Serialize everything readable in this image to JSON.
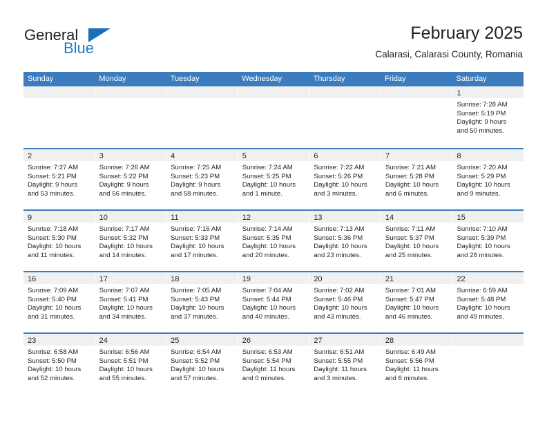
{
  "brand": {
    "name_part1": "General",
    "name_part2": "Blue"
  },
  "header": {
    "title": "February 2025",
    "subtitle": "Calarasi, Calarasi County, Romania"
  },
  "calendar": {
    "weekday_headers": [
      "Sunday",
      "Monday",
      "Tuesday",
      "Wednesday",
      "Thursday",
      "Friday",
      "Saturday"
    ],
    "accent_color": "#3a7cbe",
    "daynum_band_color": "#f0f0f0",
    "weeks": [
      [
        {
          "day": "",
          "lines": []
        },
        {
          "day": "",
          "lines": []
        },
        {
          "day": "",
          "lines": []
        },
        {
          "day": "",
          "lines": []
        },
        {
          "day": "",
          "lines": []
        },
        {
          "day": "",
          "lines": []
        },
        {
          "day": "1",
          "lines": [
            "Sunrise: 7:28 AM",
            "Sunset: 5:19 PM",
            "Daylight: 9 hours",
            "and 50 minutes."
          ]
        }
      ],
      [
        {
          "day": "2",
          "lines": [
            "Sunrise: 7:27 AM",
            "Sunset: 5:21 PM",
            "Daylight: 9 hours",
            "and 53 minutes."
          ]
        },
        {
          "day": "3",
          "lines": [
            "Sunrise: 7:26 AM",
            "Sunset: 5:22 PM",
            "Daylight: 9 hours",
            "and 56 minutes."
          ]
        },
        {
          "day": "4",
          "lines": [
            "Sunrise: 7:25 AM",
            "Sunset: 5:23 PM",
            "Daylight: 9 hours",
            "and 58 minutes."
          ]
        },
        {
          "day": "5",
          "lines": [
            "Sunrise: 7:24 AM",
            "Sunset: 5:25 PM",
            "Daylight: 10 hours",
            "and 1 minute."
          ]
        },
        {
          "day": "6",
          "lines": [
            "Sunrise: 7:22 AM",
            "Sunset: 5:26 PM",
            "Daylight: 10 hours",
            "and 3 minutes."
          ]
        },
        {
          "day": "7",
          "lines": [
            "Sunrise: 7:21 AM",
            "Sunset: 5:28 PM",
            "Daylight: 10 hours",
            "and 6 minutes."
          ]
        },
        {
          "day": "8",
          "lines": [
            "Sunrise: 7:20 AM",
            "Sunset: 5:29 PM",
            "Daylight: 10 hours",
            "and 9 minutes."
          ]
        }
      ],
      [
        {
          "day": "9",
          "lines": [
            "Sunrise: 7:18 AM",
            "Sunset: 5:30 PM",
            "Daylight: 10 hours",
            "and 11 minutes."
          ]
        },
        {
          "day": "10",
          "lines": [
            "Sunrise: 7:17 AM",
            "Sunset: 5:32 PM",
            "Daylight: 10 hours",
            "and 14 minutes."
          ]
        },
        {
          "day": "11",
          "lines": [
            "Sunrise: 7:16 AM",
            "Sunset: 5:33 PM",
            "Daylight: 10 hours",
            "and 17 minutes."
          ]
        },
        {
          "day": "12",
          "lines": [
            "Sunrise: 7:14 AM",
            "Sunset: 5:35 PM",
            "Daylight: 10 hours",
            "and 20 minutes."
          ]
        },
        {
          "day": "13",
          "lines": [
            "Sunrise: 7:13 AM",
            "Sunset: 5:36 PM",
            "Daylight: 10 hours",
            "and 23 minutes."
          ]
        },
        {
          "day": "14",
          "lines": [
            "Sunrise: 7:11 AM",
            "Sunset: 5:37 PM",
            "Daylight: 10 hours",
            "and 25 minutes."
          ]
        },
        {
          "day": "15",
          "lines": [
            "Sunrise: 7:10 AM",
            "Sunset: 5:39 PM",
            "Daylight: 10 hours",
            "and 28 minutes."
          ]
        }
      ],
      [
        {
          "day": "16",
          "lines": [
            "Sunrise: 7:09 AM",
            "Sunset: 5:40 PM",
            "Daylight: 10 hours",
            "and 31 minutes."
          ]
        },
        {
          "day": "17",
          "lines": [
            "Sunrise: 7:07 AM",
            "Sunset: 5:41 PM",
            "Daylight: 10 hours",
            "and 34 minutes."
          ]
        },
        {
          "day": "18",
          "lines": [
            "Sunrise: 7:05 AM",
            "Sunset: 5:43 PM",
            "Daylight: 10 hours",
            "and 37 minutes."
          ]
        },
        {
          "day": "19",
          "lines": [
            "Sunrise: 7:04 AM",
            "Sunset: 5:44 PM",
            "Daylight: 10 hours",
            "and 40 minutes."
          ]
        },
        {
          "day": "20",
          "lines": [
            "Sunrise: 7:02 AM",
            "Sunset: 5:46 PM",
            "Daylight: 10 hours",
            "and 43 minutes."
          ]
        },
        {
          "day": "21",
          "lines": [
            "Sunrise: 7:01 AM",
            "Sunset: 5:47 PM",
            "Daylight: 10 hours",
            "and 46 minutes."
          ]
        },
        {
          "day": "22",
          "lines": [
            "Sunrise: 6:59 AM",
            "Sunset: 5:48 PM",
            "Daylight: 10 hours",
            "and 49 minutes."
          ]
        }
      ],
      [
        {
          "day": "23",
          "lines": [
            "Sunrise: 6:58 AM",
            "Sunset: 5:50 PM",
            "Daylight: 10 hours",
            "and 52 minutes."
          ]
        },
        {
          "day": "24",
          "lines": [
            "Sunrise: 6:56 AM",
            "Sunset: 5:51 PM",
            "Daylight: 10 hours",
            "and 55 minutes."
          ]
        },
        {
          "day": "25",
          "lines": [
            "Sunrise: 6:54 AM",
            "Sunset: 5:52 PM",
            "Daylight: 10 hours",
            "and 57 minutes."
          ]
        },
        {
          "day": "26",
          "lines": [
            "Sunrise: 6:53 AM",
            "Sunset: 5:54 PM",
            "Daylight: 11 hours",
            "and 0 minutes."
          ]
        },
        {
          "day": "27",
          "lines": [
            "Sunrise: 6:51 AM",
            "Sunset: 5:55 PM",
            "Daylight: 11 hours",
            "and 3 minutes."
          ]
        },
        {
          "day": "28",
          "lines": [
            "Sunrise: 6:49 AM",
            "Sunset: 5:56 PM",
            "Daylight: 11 hours",
            "and 6 minutes."
          ]
        },
        {
          "day": "",
          "lines": []
        }
      ]
    ]
  }
}
